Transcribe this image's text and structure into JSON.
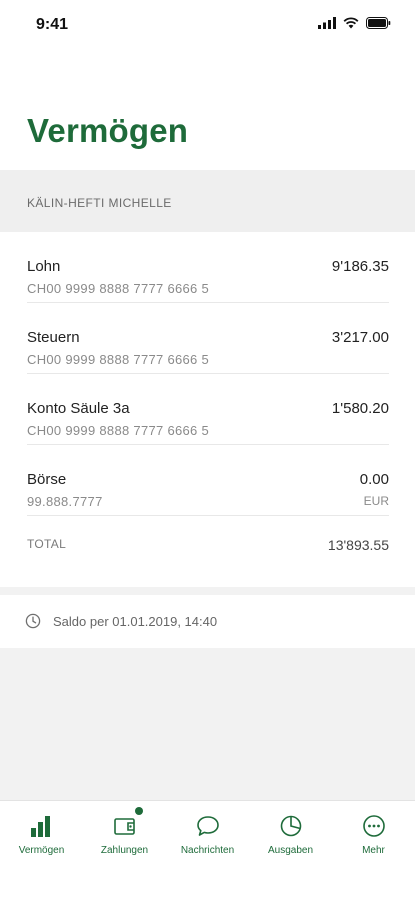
{
  "status_bar": {
    "time": "9:41",
    "icons": [
      "signal-icon",
      "wifi-icon",
      "battery-icon"
    ]
  },
  "page": {
    "title": "Vermögen",
    "owner": "KÄLIN-HEFTI MICHELLE",
    "accent_color": "#1e6b3a"
  },
  "accounts": [
    {
      "name": "Lohn",
      "iban": "CH00 9999 8888 7777 6666 5",
      "amount": "9'186.35",
      "currency": ""
    },
    {
      "name": "Steuern",
      "iban": "CH00 9999 8888 7777 6666 5",
      "amount": "3'217.00",
      "currency": ""
    },
    {
      "name": "Konto Säule 3a",
      "iban": "CH00 9999 8888 7777 6666 5",
      "amount": "1'580.20",
      "currency": ""
    },
    {
      "name": "Börse",
      "iban": "99.888.7777",
      "amount": "0.00",
      "currency": "EUR"
    }
  ],
  "total": {
    "label": "TOTAL",
    "amount": "13'893.55"
  },
  "saldo": {
    "text": "Saldo per 01.01.2019, 14:40",
    "icon": "clock-icon"
  },
  "tabbar": {
    "tabs": [
      {
        "label": "Vermögen",
        "icon": "bar-chart-icon"
      },
      {
        "label": "Zahlungen",
        "icon": "wallet-icon",
        "badge": true
      },
      {
        "label": "Nachrichten",
        "icon": "chat-icon"
      },
      {
        "label": "Ausgaben",
        "icon": "pie-chart-icon"
      },
      {
        "label": "Mehr",
        "icon": "more-icon"
      }
    ]
  }
}
